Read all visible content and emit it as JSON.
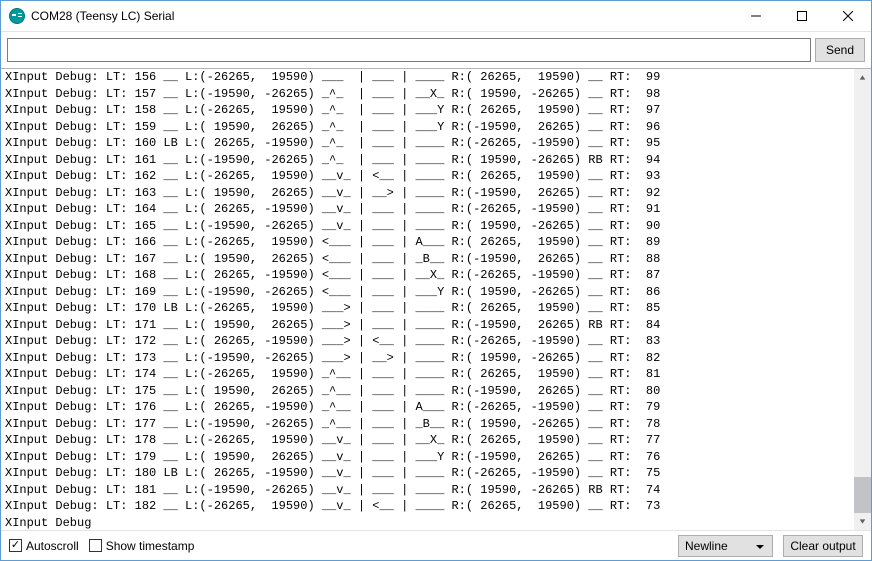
{
  "window_title": "COM28 (Teensy LC) Serial",
  "input_value": "",
  "send_label": "Send",
  "autoscroll_label": "Autoscroll",
  "autoscroll_checked": true,
  "timestamp_label": "Show timestamp",
  "timestamp_checked": false,
  "line_ending_selected": "Newline",
  "clear_label": "Clear output",
  "console_lines": [
    "XInput Debug: LT: 156 __ L:(-26265,  19590) ___  | ___ | ____ R:( 26265,  19590) __ RT:  99",
    "XInput Debug: LT: 157 __ L:(-19590, -26265) _^_  | ___ | __X_ R:( 19590, -26265) __ RT:  98",
    "XInput Debug: LT: 158 __ L:(-26265,  19590) _^_  | ___ | ___Y R:( 26265,  19590) __ RT:  97",
    "XInput Debug: LT: 159 __ L:( 19590,  26265) _^_  | ___ | ___Y R:(-19590,  26265) __ RT:  96",
    "XInput Debug: LT: 160 LB L:( 26265, -19590) _^_  | ___ | ____ R:(-26265, -19590) __ RT:  95",
    "XInput Debug: LT: 161 __ L:(-19590, -26265) _^_  | ___ | ____ R:( 19590, -26265) RB RT:  94",
    "XInput Debug: LT: 162 __ L:(-26265,  19590) __v_ | <__ | ____ R:( 26265,  19590) __ RT:  93",
    "XInput Debug: LT: 163 __ L:( 19590,  26265) __v_ | __> | ____ R:(-19590,  26265) __ RT:  92",
    "XInput Debug: LT: 164 __ L:( 26265, -19590) __v_ | ___ | ____ R:(-26265, -19590) __ RT:  91",
    "XInput Debug: LT: 165 __ L:(-19590, -26265) __v_ | ___ | ____ R:( 19590, -26265) __ RT:  90",
    "XInput Debug: LT: 166 __ L:(-26265,  19590) <___ | ___ | A___ R:( 26265,  19590) __ RT:  89",
    "XInput Debug: LT: 167 __ L:( 19590,  26265) <___ | ___ | _B__ R:(-19590,  26265) __ RT:  88",
    "XInput Debug: LT: 168 __ L:( 26265, -19590) <___ | ___ | __X_ R:(-26265, -19590) __ RT:  87",
    "XInput Debug: LT: 169 __ L:(-19590, -26265) <___ | ___ | ___Y R:( 19590, -26265) __ RT:  86",
    "XInput Debug: LT: 170 LB L:(-26265,  19590) ___> | ___ | ____ R:( 26265,  19590) __ RT:  85",
    "XInput Debug: LT: 171 __ L:( 19590,  26265) ___> | ___ | ____ R:(-19590,  26265) RB RT:  84",
    "XInput Debug: LT: 172 __ L:( 26265, -19590) ___> | <__ | ____ R:(-26265, -19590) __ RT:  83",
    "XInput Debug: LT: 173 __ L:(-19590, -26265) ___> | __> | ____ R:( 19590, -26265) __ RT:  82",
    "XInput Debug: LT: 174 __ L:(-26265,  19590) _^__ | ___ | ____ R:( 26265,  19590) __ RT:  81",
    "XInput Debug: LT: 175 __ L:( 19590,  26265) _^__ | ___ | ____ R:(-19590,  26265) __ RT:  80",
    "XInput Debug: LT: 176 __ L:( 26265, -19590) _^__ | ___ | A___ R:(-26265, -19590) __ RT:  79",
    "XInput Debug: LT: 177 __ L:(-19590, -26265) _^__ | ___ | _B__ R:( 19590, -26265) __ RT:  78",
    "XInput Debug: LT: 178 __ L:(-26265,  19590) __v_ | ___ | __X_ R:( 26265,  19590) __ RT:  77",
    "XInput Debug: LT: 179 __ L:( 19590,  26265) __v_ | ___ | ___Y R:(-19590,  26265) __ RT:  76",
    "XInput Debug: LT: 180 LB L:( 26265, -19590) __v_ | ___ | ____ R:(-26265, -19590) __ RT:  75",
    "XInput Debug: LT: 181 __ L:(-19590, -26265) __v_ | ___ | ____ R:( 19590, -26265) RB RT:  74",
    "XInput Debug: LT: 182 __ L:(-26265,  19590) __v_ | <__ | ____ R:( 26265,  19590) __ RT:  73",
    "XInput Debug"
  ]
}
